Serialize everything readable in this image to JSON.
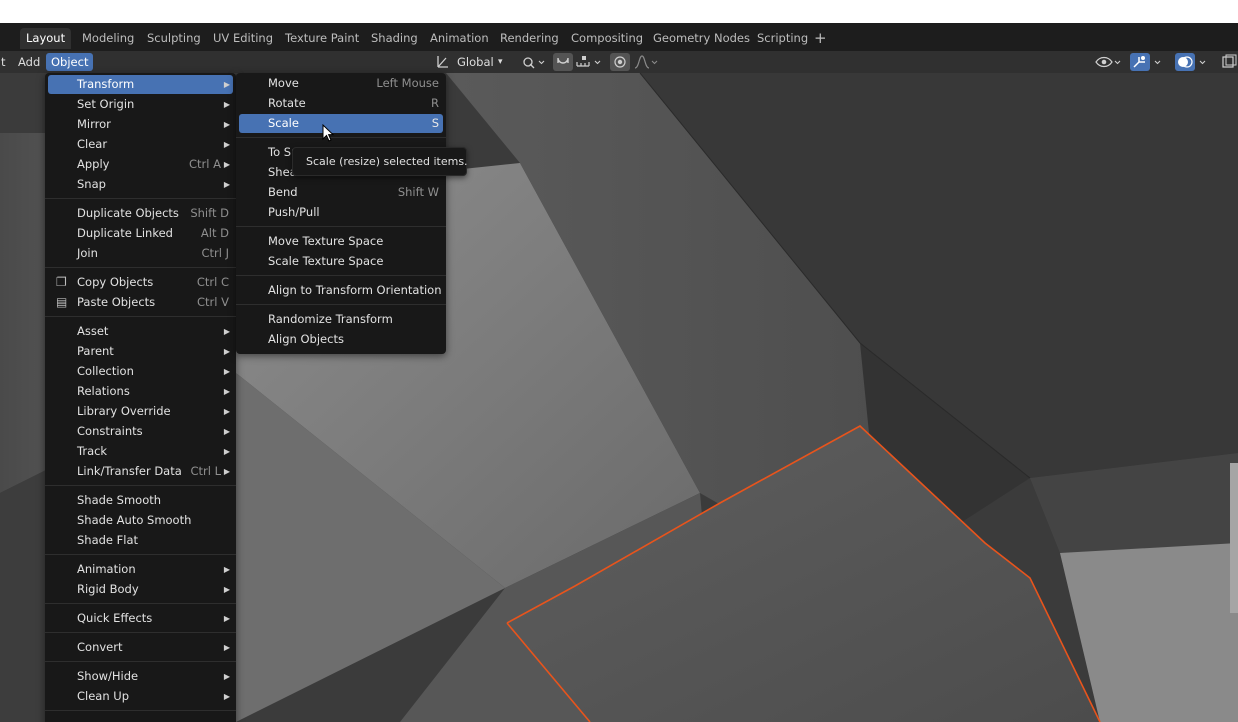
{
  "workspace_tabs": [
    "Layout",
    "Modeling",
    "Sculpting",
    "UV Editing",
    "Texture Paint",
    "Shading",
    "Animation",
    "Rendering",
    "Compositing",
    "Geometry Nodes",
    "Scripting"
  ],
  "workspace_add": "+",
  "header": {
    "left_fragment": "t",
    "add_label": "Add",
    "object_label": "Object",
    "orientation": "Global"
  },
  "object_menu": {
    "items": [
      {
        "label": "Transform",
        "shortcut": "",
        "submenu": true
      },
      {
        "label": "Set Origin",
        "shortcut": "",
        "submenu": true
      },
      {
        "label": "Mirror",
        "shortcut": "",
        "submenu": true
      },
      {
        "label": "Clear",
        "shortcut": "",
        "submenu": true
      },
      {
        "label": "Apply",
        "shortcut": "Ctrl A",
        "submenu": true
      },
      {
        "label": "Snap",
        "shortcut": "",
        "submenu": true
      },
      {
        "label": "Duplicate Objects",
        "shortcut": "Shift D",
        "submenu": false
      },
      {
        "label": "Duplicate Linked",
        "shortcut": "Alt D",
        "submenu": false
      },
      {
        "label": "Join",
        "shortcut": "Ctrl J",
        "submenu": false
      },
      {
        "label": "Copy Objects",
        "shortcut": "Ctrl C",
        "submenu": false
      },
      {
        "label": "Paste Objects",
        "shortcut": "Ctrl V",
        "submenu": false
      },
      {
        "label": "Asset",
        "shortcut": "",
        "submenu": true
      },
      {
        "label": "Parent",
        "shortcut": "",
        "submenu": true
      },
      {
        "label": "Collection",
        "shortcut": "",
        "submenu": true
      },
      {
        "label": "Relations",
        "shortcut": "",
        "submenu": true
      },
      {
        "label": "Library Override",
        "shortcut": "",
        "submenu": true
      },
      {
        "label": "Constraints",
        "shortcut": "",
        "submenu": true
      },
      {
        "label": "Track",
        "shortcut": "",
        "submenu": true
      },
      {
        "label": "Link/Transfer Data",
        "shortcut": "Ctrl L",
        "submenu": true
      },
      {
        "label": "Shade Smooth",
        "shortcut": "",
        "submenu": false
      },
      {
        "label": "Shade Auto Smooth",
        "shortcut": "",
        "submenu": false
      },
      {
        "label": "Shade Flat",
        "shortcut": "",
        "submenu": false
      },
      {
        "label": "Animation",
        "shortcut": "",
        "submenu": true
      },
      {
        "label": "Rigid Body",
        "shortcut": "",
        "submenu": true
      },
      {
        "label": "Quick Effects",
        "shortcut": "",
        "submenu": true
      },
      {
        "label": "Convert",
        "shortcut": "",
        "submenu": true
      },
      {
        "label": "Show/Hide",
        "shortcut": "",
        "submenu": true
      },
      {
        "label": "Clean Up",
        "shortcut": "",
        "submenu": true
      }
    ]
  },
  "transform_menu": {
    "items": [
      {
        "label": "Move",
        "shortcut": "Left Mouse"
      },
      {
        "label": "Rotate",
        "shortcut": "R"
      },
      {
        "label": "Scale",
        "shortcut": "S"
      },
      {
        "label": "To Sp",
        "shortcut": ""
      },
      {
        "label": "Shea",
        "shortcut": ""
      },
      {
        "label": "Bend",
        "shortcut": "Shift W"
      },
      {
        "label": "Push/Pull",
        "shortcut": ""
      },
      {
        "label": "Move Texture Space",
        "shortcut": ""
      },
      {
        "label": "Scale Texture Space",
        "shortcut": ""
      },
      {
        "label": "Align to Transform Orientation",
        "shortcut": ""
      },
      {
        "label": "Randomize Transform",
        "shortcut": ""
      },
      {
        "label": "Align Objects",
        "shortcut": ""
      }
    ]
  },
  "tooltip": "Scale (resize) selected items.",
  "colors": {
    "accent": "#4772b3",
    "menu_bg": "#181818",
    "selection_outline": "#e8541c"
  },
  "icons": {
    "copy_objects": "copy-icon",
    "paste_objects": "paste-icon",
    "submenu_arrow": "chevron-right-icon"
  }
}
